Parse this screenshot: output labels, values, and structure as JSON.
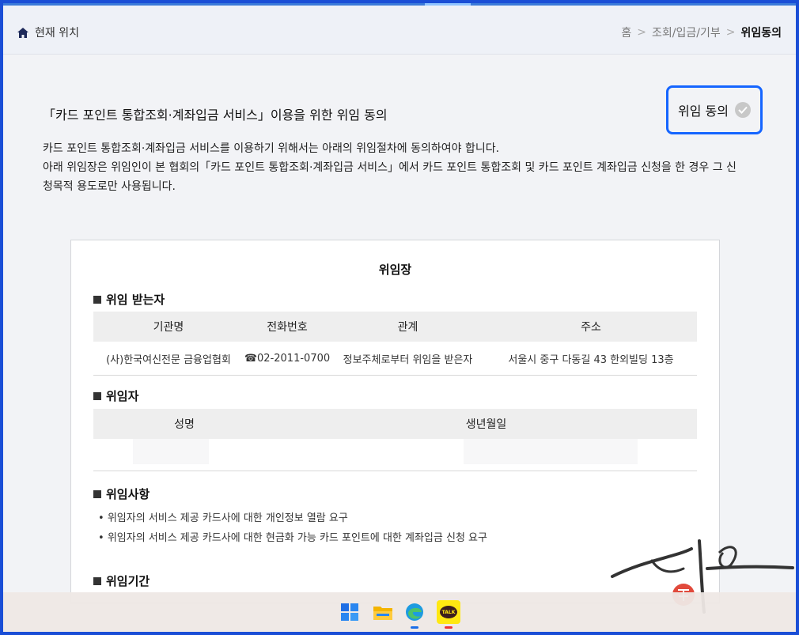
{
  "location": {
    "label": "현재 위치",
    "icon": "home-icon"
  },
  "breadcrumb": {
    "items": [
      "홈",
      "조회/입금/기부"
    ],
    "current": "위임동의",
    "separator": ">"
  },
  "heading": "「카드 포인트 통합조회·계좌입금 서비스」이용을 위한 위임 동의",
  "agree_button": {
    "label": "위임 동의",
    "accent": "#1565ff"
  },
  "description": [
    "카드 포인트 통합조회·계좌입금 서비스를 이용하기 위해서는 아래의 위임절차에 동의하여야 합니다.",
    "아래 위임장은 위임인이 본 협회의「카드 포인트 통합조회·계좌입금 서비스」에서 카드 포인트 통합조회 및 카드 포인트 계좌입금 신청을 한 경우 그 신",
    "청목적 용도로만 사용됩니다."
  ],
  "document": {
    "title": "위임장",
    "receiver": {
      "heading": "위임 받는자",
      "columns": [
        "기관명",
        "전화번호",
        "관계",
        "주소"
      ],
      "row": [
        "(사)한국여신전문 금융업협회",
        "☎02-2011-0700",
        "정보주체로부터 위임을 받은자",
        "서울시 중구 다동길 43 한외빌딩 13층"
      ]
    },
    "delegator": {
      "heading": "위임자",
      "columns": [
        "성명",
        "생년월일"
      ]
    },
    "matters": {
      "heading": "위임사항",
      "items": [
        "위임자의 서비스 제공 카드사에 대한 개인정보 열람 요구",
        "위임자의 서비스 제공 카드사에 대한 현금화 가능 카드 포인트에 대한 계좌입금 신청 요구"
      ]
    },
    "period": {
      "heading": "위임기간"
    }
  },
  "taskbar": {
    "icons": [
      "windows-start-icon",
      "file-explorer-icon",
      "edge-browser-icon",
      "kakaotalk-icon"
    ],
    "kakao_label": "TALK"
  }
}
